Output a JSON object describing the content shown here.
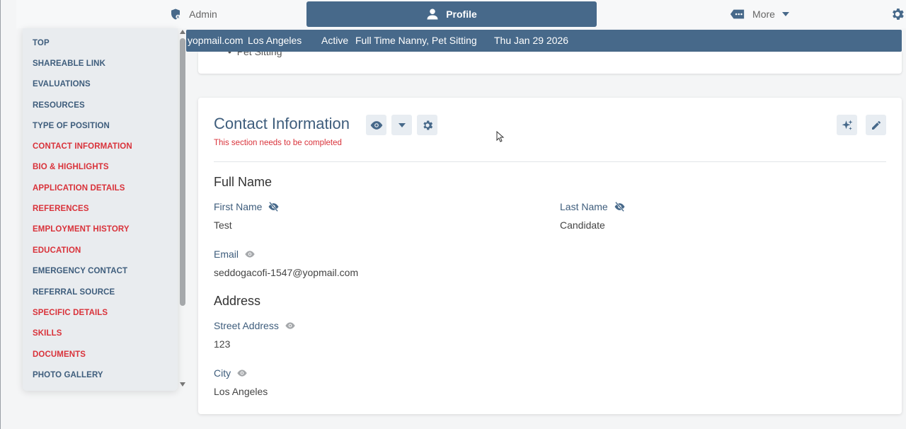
{
  "tabs": {
    "admin": "Admin",
    "profile": "Profile",
    "more": "More"
  },
  "summary": {
    "email_partial": "yopmail.com",
    "city": "Los Angeles",
    "status": "Active",
    "positions": "Full Time Nanny, Pet Sitting",
    "date": "Thu Jan 29 2026"
  },
  "prev_card": {
    "bullet": "Pet Sitting"
  },
  "sidebar": {
    "items": [
      {
        "label": "TOP"
      },
      {
        "label": "SHAREABLE LINK"
      },
      {
        "label": "EVALUATIONS"
      },
      {
        "label": "RESOURCES"
      },
      {
        "label": "TYPE OF POSITION"
      },
      {
        "label": "CONTACT INFORMATION"
      },
      {
        "label": "BIO & HIGHLIGHTS"
      },
      {
        "label": "APPLICATION DETAILS"
      },
      {
        "label": "REFERENCES"
      },
      {
        "label": "EMPLOYMENT HISTORY"
      },
      {
        "label": "EDUCATION"
      },
      {
        "label": "EMERGENCY CONTACT"
      },
      {
        "label": "REFERRAL SOURCE"
      },
      {
        "label": "SPECIFIC DETAILS"
      },
      {
        "label": "SKILLS"
      },
      {
        "label": "DOCUMENTS"
      },
      {
        "label": "PHOTO GALLERY"
      }
    ]
  },
  "contact": {
    "title": "Contact Information",
    "warning": "This section needs to be completed",
    "full_name_heading": "Full Name",
    "first_name_label": "First Name",
    "first_name_value": "Test",
    "last_name_label": "Last Name",
    "last_name_value": "Candidate",
    "email_label": "Email",
    "email_value": "seddogacofi-1547@yopmail.com",
    "address_heading": "Address",
    "street_label": "Street Address",
    "street_value": "123",
    "city_label": "City",
    "city_value": "Los Angeles"
  },
  "colors": {
    "brand": "#47698a",
    "label": "#3e5d7c",
    "warning": "#d9323a",
    "sidebar_bg": "#e9ecef"
  },
  "icons": {
    "admin": "shield-user-icon",
    "profile": "person-icon",
    "more": "tag-dots-icon",
    "settings": "gear-icon",
    "visible": "eye-icon",
    "hidden": "eye-off-icon",
    "dropdown": "caret-down-icon",
    "ai": "sparkles-icon",
    "edit": "pencil-icon"
  }
}
